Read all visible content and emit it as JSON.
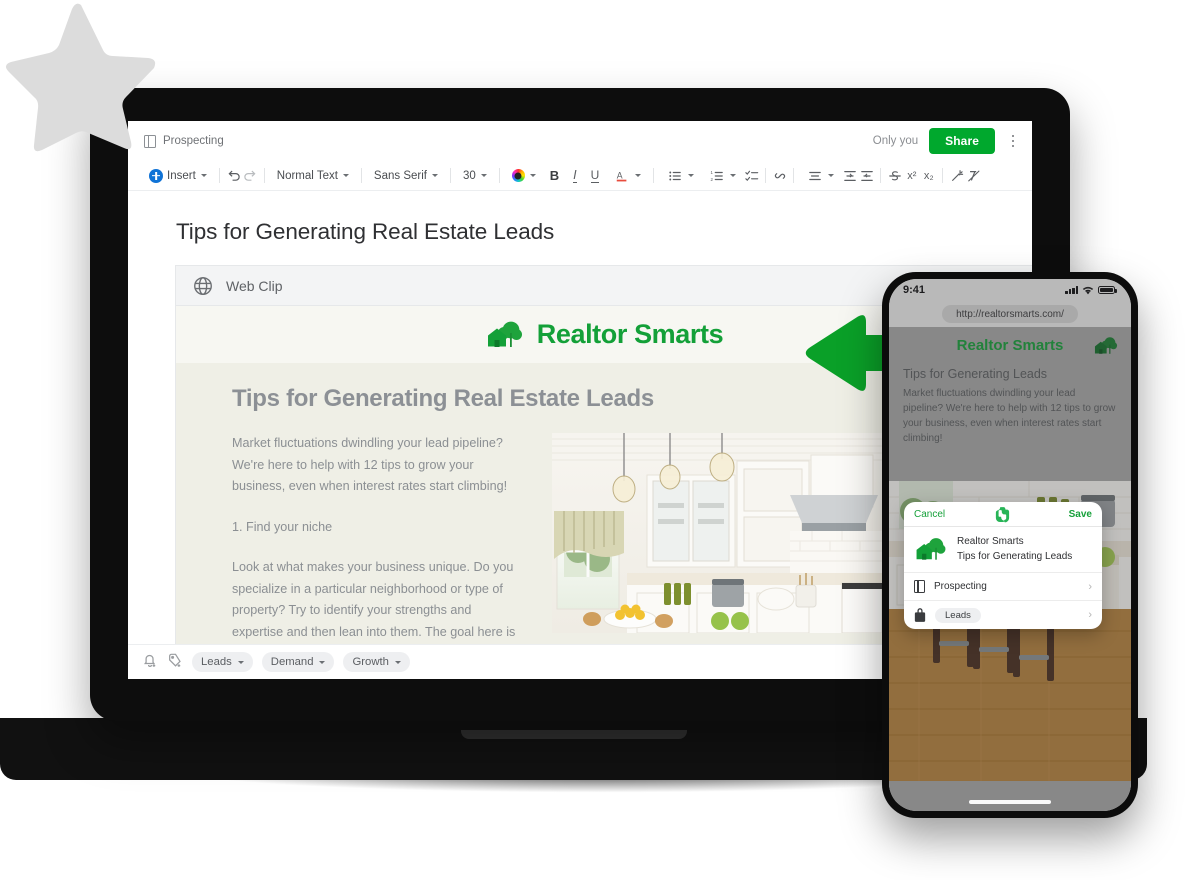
{
  "document": {
    "notebook": "Prospecting",
    "notebook_icon": "notebook-icon",
    "sharing_status": "Only you",
    "share_label": "Share",
    "more_icon": "kebab-menu-icon",
    "title": "Tips for Generating Real Estate Leads"
  },
  "toolbar": {
    "insert_label": "Insert",
    "undo_icon": "undo-icon",
    "redo_icon": "redo-icon",
    "style": "Normal Text",
    "font": "Sans Serif",
    "size": "30",
    "color_icon": "text-color-icon",
    "bold": "B",
    "italic": "I",
    "underline": "U",
    "highlight_icon": "highlight-color-icon",
    "bullet_list_icon": "bulleted-list-icon",
    "numbered_list_icon": "numbered-list-icon",
    "checklist_icon": "checklist-icon",
    "link_icon": "link-icon",
    "align_icon": "align-icon",
    "indent_icon": "indent-increase-icon",
    "outdent_icon": "indent-decrease-icon",
    "strikethrough_icon": "strikethrough-icon",
    "superscript": "x²",
    "subscript": "x₂",
    "ai_icon": "magic-wand-icon",
    "clear_format_icon": "clear-formatting-icon"
  },
  "web_clip": {
    "header_label": "Web Clip",
    "header_icon": "globe-icon",
    "brand": "Realtor Smarts",
    "brand_logo_icon": "house-tree-logo-icon",
    "heading": "Tips for Generating Real Estate Leads",
    "paragraphs": [
      "Market fluctuations dwindling your lead pipeline? We're here to help with 12 tips to grow your business, even when interest rates start climbing!",
      "1. Find your niche",
      "Look at what makes your business unique. Do you specialize in a particular neighborhood or type of property? Try to identify your strengths and expertise and then lean into them. The goal here is to become the go-to realtor for a specific (but not"
    ],
    "photo_alt": "bright white kitchen with pendant lights and island"
  },
  "footer": {
    "reminder_icon": "add-reminder-bell-icon",
    "tag_icon": "add-tag-icon",
    "tags": [
      "Leads",
      "Demand",
      "Growth"
    ]
  },
  "arrow": {
    "icon": "left-arrow-icon",
    "color": "#0aa028"
  },
  "decoration": {
    "star_icon": "star-shape",
    "color": "#dcdcdc"
  },
  "phone": {
    "status": {
      "time": "9:41",
      "signal_icon": "cellular-bars-icon",
      "wifi_icon": "wifi-icon",
      "battery_icon": "battery-full-icon"
    },
    "url": "http://realtorsmarts.com/",
    "page": {
      "brand": "Realtor Smarts",
      "brand_logo_icon": "house-tree-logo-icon",
      "heading": "Tips for Generating Leads",
      "body": "Market fluctuations dwindling your lead pipeline? We're here to help with 12 tips to grow your business, even when interest rates start climbing!"
    },
    "sheet": {
      "cancel": "Cancel",
      "app_icon": "evernote-elephant-icon",
      "save": "Save",
      "note_logo_icon": "house-tree-logo-icon",
      "note_source": "Realtor Smarts",
      "note_title": "Tips for Generating Leads",
      "rows": [
        {
          "icon": "notebook-icon",
          "label": "Prospecting",
          "chevron": "›",
          "is_pill": false
        },
        {
          "icon": "tag-icon",
          "label": "Leads",
          "chevron": "›",
          "is_pill": true
        }
      ]
    }
  },
  "colors": {
    "brand_green": "#00a82d",
    "logo_green": "#13a038",
    "arrow_green": "#0aa028"
  }
}
